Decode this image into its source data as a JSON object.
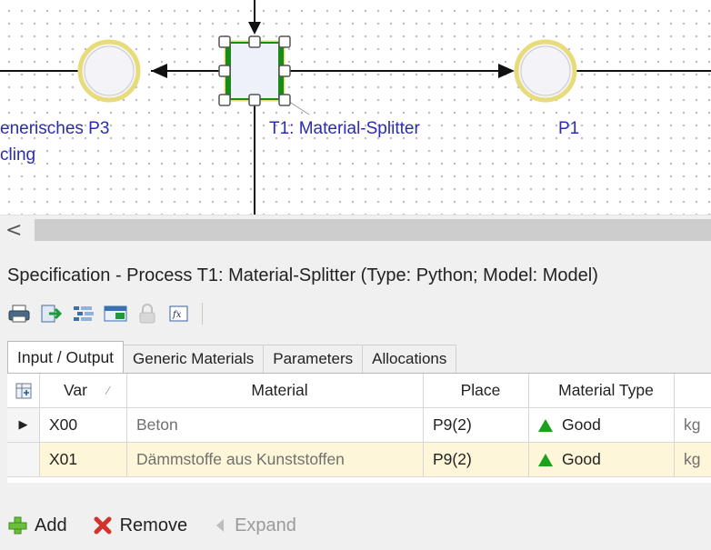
{
  "canvas": {
    "labels": {
      "p3": "enerisches  P3",
      "p3_line2": "cling",
      "t1": "T1: Material-Splitter",
      "p1": "P1"
    }
  },
  "scrollbar": {
    "left_arrow": "<"
  },
  "spec": {
    "title": "Specification - Process T1: Material-Splitter (Type: Python; Model: Model)",
    "toolbar": [
      "print-icon",
      "export-icon",
      "list-icon",
      "table-icon",
      "lock-icon",
      "function-icon"
    ],
    "tabs": [
      {
        "label": "Input / Output",
        "active": true
      },
      {
        "label": "Generic Materials",
        "active": false
      },
      {
        "label": "Parameters",
        "active": false
      },
      {
        "label": "Allocations",
        "active": false
      }
    ],
    "columns": {
      "var": "Var",
      "material": "Material",
      "place": "Place",
      "type": "Material Type"
    },
    "rows": [
      {
        "marker": "▶",
        "var": "X00",
        "material": "Beton",
        "place": "P9(2)",
        "type": "Good",
        "unit": "kg"
      },
      {
        "marker": "",
        "var": "X01",
        "material": "Dämmstoffe aus Kunststoffen",
        "place": "P9(2)",
        "type": "Good",
        "unit": "kg"
      }
    ],
    "actions": {
      "add": "Add",
      "remove": "Remove",
      "expand": "Expand"
    }
  }
}
